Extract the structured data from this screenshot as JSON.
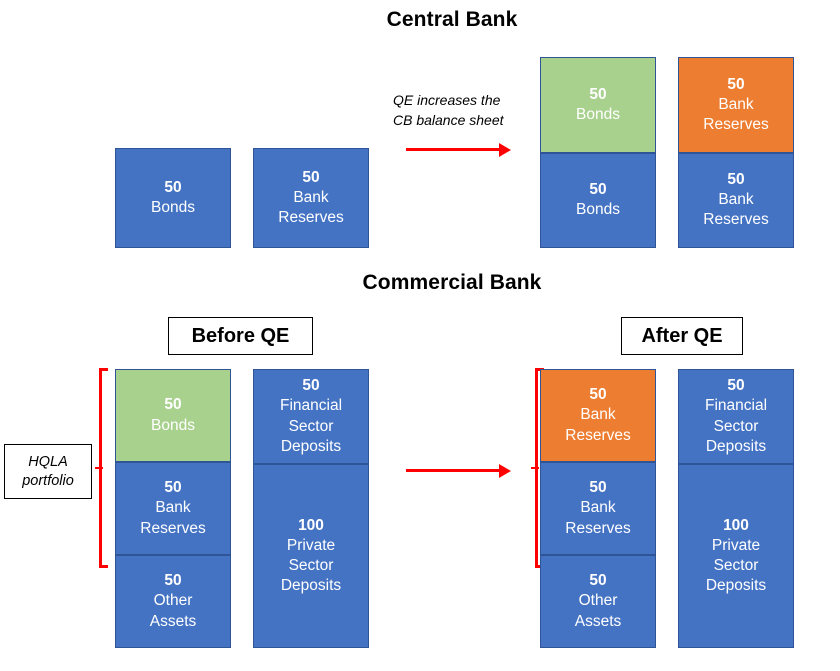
{
  "colors": {
    "blue": "#4573C4",
    "blue_border": "#2F5597",
    "green": "#A9D18E",
    "orange": "#ED7D31",
    "red": "#FF0000",
    "text_on_fill": "#FFFFFF",
    "text": "#000000"
  },
  "headings": {
    "central_bank": "Central Bank",
    "commercial_bank": "Commercial Bank"
  },
  "scenario_labels": {
    "before": "Before QE",
    "after": "After QE"
  },
  "annotations": {
    "qe_note_line1": "QE increases the",
    "qe_note_line2": "CB balance sheet",
    "hqla_line1": "HQLA",
    "hqla_line2": "portfolio"
  },
  "central_bank": {
    "before": {
      "assets": [
        {
          "amount": "50",
          "label": "Bonds",
          "fill": "blue"
        }
      ],
      "liabilities": [
        {
          "amount": "50",
          "label": "Bank Reserves",
          "fill": "blue"
        }
      ]
    },
    "after": {
      "assets": [
        {
          "amount": "50",
          "label": "Bonds",
          "fill": "green"
        },
        {
          "amount": "50",
          "label": "Bonds",
          "fill": "blue"
        }
      ],
      "liabilities": [
        {
          "amount": "50",
          "label": "Bank Reserves",
          "fill": "orange"
        },
        {
          "amount": "50",
          "label": "Bank Reserves",
          "fill": "blue"
        }
      ]
    }
  },
  "commercial_bank": {
    "before": {
      "assets": [
        {
          "amount": "50",
          "label": "Bonds",
          "fill": "green"
        },
        {
          "amount": "50",
          "label": "Bank Reserves",
          "fill": "blue"
        },
        {
          "amount": "50",
          "label": "Other Assets",
          "fill": "blue"
        }
      ],
      "liabilities": [
        {
          "amount": "50",
          "label": "Financial Sector Deposits",
          "fill": "blue"
        },
        {
          "amount": "100",
          "label": "Private Sector Deposits",
          "fill": "blue"
        }
      ]
    },
    "after": {
      "assets": [
        {
          "amount": "50",
          "label": "Bank Reserves",
          "fill": "orange"
        },
        {
          "amount": "50",
          "label": "Bank Reserves",
          "fill": "blue"
        },
        {
          "amount": "50",
          "label": "Other Assets",
          "fill": "blue"
        }
      ],
      "liabilities": [
        {
          "amount": "50",
          "label": "Financial Sector Deposits",
          "fill": "blue"
        },
        {
          "amount": "100",
          "label": "Private Sector Deposits",
          "fill": "blue"
        }
      ]
    }
  }
}
